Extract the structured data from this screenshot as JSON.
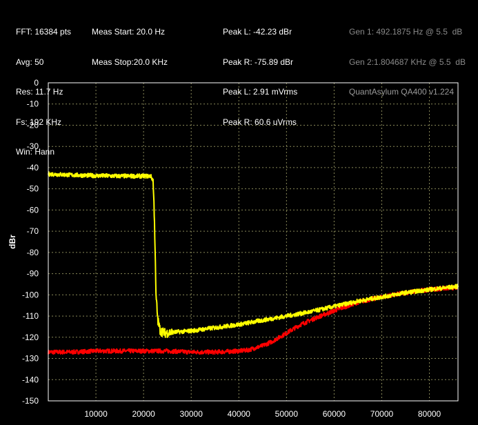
{
  "info": {
    "col1": [
      "FFT: 16384 pts",
      "Avg: 50",
      "Res: 11.7 Hz",
      "Fs: 192 KHz",
      "Win: Hann"
    ],
    "col2": [
      "Meas Start: 20.0 Hz",
      "Meas Stop:20.0 KHz"
    ],
    "col3": [
      "Peak L: -42.23 dBr",
      "Peak R: -75.89 dBr",
      "Peak L: 2.91 mVrms",
      "Peak R: 60.6 uVrms"
    ],
    "col4": [
      "Gen 1: 492.1875 Hz @ 5.5  dB",
      "Gen 2:1.804687 KHz @ 5.5  dB"
    ]
  },
  "watermark": "QuantAsylum QA400 v1.224",
  "colors": {
    "background": "#000000",
    "plot_border": "#ffffff",
    "grid": "#8a8a5a",
    "series_left": "#ffff00",
    "series_right": "#ff0000",
    "gen_text": "#8a8a8a"
  },
  "chart_data": {
    "type": "line",
    "title": "",
    "xlabel": "",
    "ylabel": "dBr",
    "xlim": [
      0,
      86000
    ],
    "ylim": [
      -150,
      0
    ],
    "x_ticks": [
      10000,
      20000,
      30000,
      40000,
      50000,
      60000,
      70000,
      80000
    ],
    "y_ticks": [
      0,
      -10,
      -20,
      -30,
      -40,
      -50,
      -60,
      -70,
      -80,
      -90,
      -100,
      -110,
      -120,
      -130,
      -140,
      -150
    ],
    "grid": true,
    "legend": "none",
    "series": [
      {
        "color": "#ffff00",
        "x": [
          0,
          5000,
          10000,
          15000,
          20000,
          21500,
          22000,
          22300,
          22600,
          23000,
          23500,
          24500,
          27000,
          30000,
          35000,
          40000,
          45000,
          50000,
          55000,
          60000,
          65000,
          70000,
          75000,
          80000,
          86000
        ],
        "y": [
          -43,
          -43.5,
          -43.8,
          -44,
          -44,
          -44,
          -46,
          -65,
          -100,
          -112,
          -117,
          -118,
          -117.5,
          -117,
          -115.5,
          -114,
          -112,
          -110,
          -108,
          -105.5,
          -103,
          -101,
          -99,
          -97.5,
          -96
        ]
      },
      {
        "color": "#ff0000",
        "x": [
          0,
          5000,
          10000,
          15000,
          20000,
          25000,
          30000,
          35000,
          40000,
          42000,
          45000,
          47000,
          50000,
          53000,
          56000,
          60000,
          65000,
          70000,
          75000,
          80000,
          86000
        ],
        "y": [
          -127,
          -127,
          -126.5,
          -126.5,
          -126.5,
          -126.5,
          -127,
          -127,
          -126.5,
          -126,
          -124,
          -122,
          -118,
          -114,
          -111,
          -107.5,
          -103.5,
          -101,
          -99,
          -97.5,
          -96.5
        ]
      }
    ]
  }
}
